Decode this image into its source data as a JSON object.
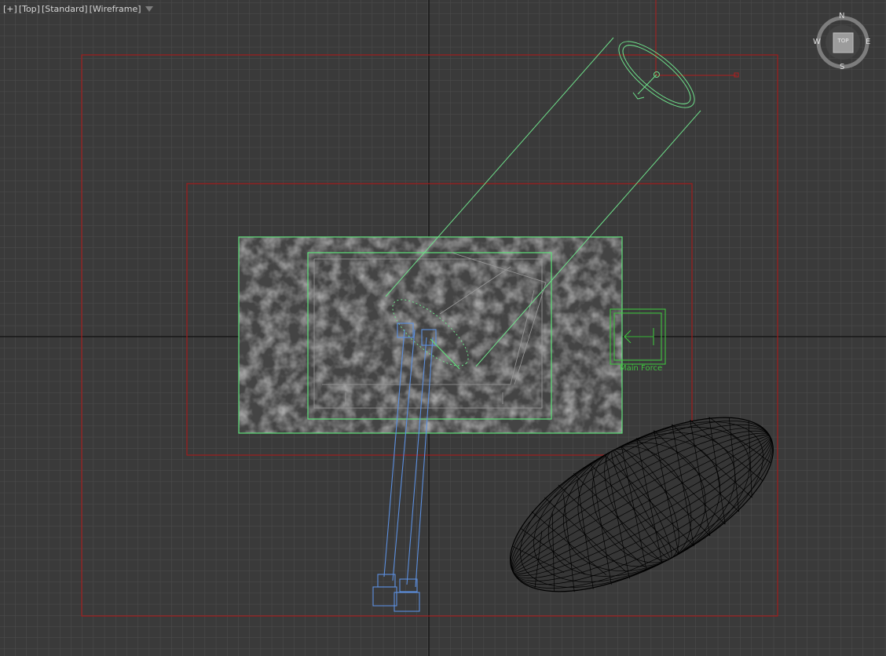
{
  "viewport": {
    "label_parts": [
      "[+]",
      "[Top]",
      "[Standard]",
      "[Wireframe]"
    ],
    "filter_icon": "funnel-icon"
  },
  "viewcube": {
    "face": "TOP",
    "compass": {
      "north": "N",
      "south": "S",
      "east": "E",
      "west": "W"
    }
  },
  "objects": {
    "force_label": "Main Force"
  },
  "colors": {
    "background": "#3a3a3a",
    "grid_minor": "#4e4e4e",
    "grid_major": "#000000",
    "selection_green": "#5fe07a",
    "red_frame": "#9b1b1b",
    "blue_rig": "#5b8fe0",
    "mesh_black": "#000000"
  }
}
